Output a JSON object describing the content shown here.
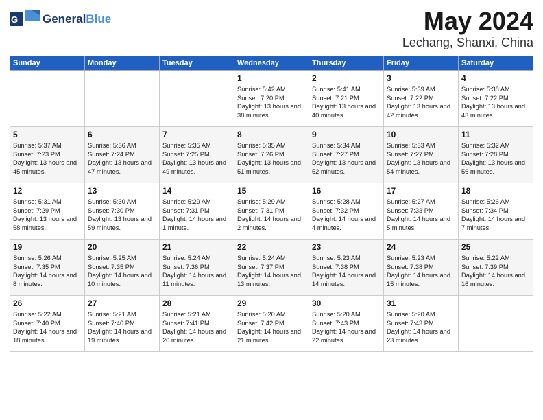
{
  "header": {
    "logo_general": "General",
    "logo_blue": "Blue",
    "month": "May 2024",
    "location": "Lechang, Shanxi, China"
  },
  "weekdays": [
    "Sunday",
    "Monday",
    "Tuesday",
    "Wednesday",
    "Thursday",
    "Friday",
    "Saturday"
  ],
  "weeks": [
    [
      {
        "day": "",
        "sunrise": "",
        "sunset": "",
        "daylight": ""
      },
      {
        "day": "",
        "sunrise": "",
        "sunset": "",
        "daylight": ""
      },
      {
        "day": "",
        "sunrise": "",
        "sunset": "",
        "daylight": ""
      },
      {
        "day": "1",
        "sunrise": "Sunrise: 5:42 AM",
        "sunset": "Sunset: 7:20 PM",
        "daylight": "Daylight: 13 hours and 38 minutes."
      },
      {
        "day": "2",
        "sunrise": "Sunrise: 5:41 AM",
        "sunset": "Sunset: 7:21 PM",
        "daylight": "Daylight: 13 hours and 40 minutes."
      },
      {
        "day": "3",
        "sunrise": "Sunrise: 5:39 AM",
        "sunset": "Sunset: 7:22 PM",
        "daylight": "Daylight: 13 hours and 42 minutes."
      },
      {
        "day": "4",
        "sunrise": "Sunrise: 5:38 AM",
        "sunset": "Sunset: 7:22 PM",
        "daylight": "Daylight: 13 hours and 43 minutes."
      }
    ],
    [
      {
        "day": "5",
        "sunrise": "Sunrise: 5:37 AM",
        "sunset": "Sunset: 7:23 PM",
        "daylight": "Daylight: 13 hours and 45 minutes."
      },
      {
        "day": "6",
        "sunrise": "Sunrise: 5:36 AM",
        "sunset": "Sunset: 7:24 PM",
        "daylight": "Daylight: 13 hours and 47 minutes."
      },
      {
        "day": "7",
        "sunrise": "Sunrise: 5:35 AM",
        "sunset": "Sunset: 7:25 PM",
        "daylight": "Daylight: 13 hours and 49 minutes."
      },
      {
        "day": "8",
        "sunrise": "Sunrise: 5:35 AM",
        "sunset": "Sunset: 7:26 PM",
        "daylight": "Daylight: 13 hours and 51 minutes."
      },
      {
        "day": "9",
        "sunrise": "Sunrise: 5:34 AM",
        "sunset": "Sunset: 7:27 PM",
        "daylight": "Daylight: 13 hours and 52 minutes."
      },
      {
        "day": "10",
        "sunrise": "Sunrise: 5:33 AM",
        "sunset": "Sunset: 7:27 PM",
        "daylight": "Daylight: 13 hours and 54 minutes."
      },
      {
        "day": "11",
        "sunrise": "Sunrise: 5:32 AM",
        "sunset": "Sunset: 7:28 PM",
        "daylight": "Daylight: 13 hours and 56 minutes."
      }
    ],
    [
      {
        "day": "12",
        "sunrise": "Sunrise: 5:31 AM",
        "sunset": "Sunset: 7:29 PM",
        "daylight": "Daylight: 13 hours and 58 minutes."
      },
      {
        "day": "13",
        "sunrise": "Sunrise: 5:30 AM",
        "sunset": "Sunset: 7:30 PM",
        "daylight": "Daylight: 13 hours and 59 minutes."
      },
      {
        "day": "14",
        "sunrise": "Sunrise: 5:29 AM",
        "sunset": "Sunset: 7:31 PM",
        "daylight": "Daylight: 14 hours and 1 minute."
      },
      {
        "day": "15",
        "sunrise": "Sunrise: 5:29 AM",
        "sunset": "Sunset: 7:31 PM",
        "daylight": "Daylight: 14 hours and 2 minutes."
      },
      {
        "day": "16",
        "sunrise": "Sunrise: 5:28 AM",
        "sunset": "Sunset: 7:32 PM",
        "daylight": "Daylight: 14 hours and 4 minutes."
      },
      {
        "day": "17",
        "sunrise": "Sunrise: 5:27 AM",
        "sunset": "Sunset: 7:33 PM",
        "daylight": "Daylight: 14 hours and 5 minutes."
      },
      {
        "day": "18",
        "sunrise": "Sunrise: 5:26 AM",
        "sunset": "Sunset: 7:34 PM",
        "daylight": "Daylight: 14 hours and 7 minutes."
      }
    ],
    [
      {
        "day": "19",
        "sunrise": "Sunrise: 5:26 AM",
        "sunset": "Sunset: 7:35 PM",
        "daylight": "Daylight: 14 hours and 8 minutes."
      },
      {
        "day": "20",
        "sunrise": "Sunrise: 5:25 AM",
        "sunset": "Sunset: 7:35 PM",
        "daylight": "Daylight: 14 hours and 10 minutes."
      },
      {
        "day": "21",
        "sunrise": "Sunrise: 5:24 AM",
        "sunset": "Sunset: 7:36 PM",
        "daylight": "Daylight: 14 hours and 11 minutes."
      },
      {
        "day": "22",
        "sunrise": "Sunrise: 5:24 AM",
        "sunset": "Sunset: 7:37 PM",
        "daylight": "Daylight: 14 hours and 13 minutes."
      },
      {
        "day": "23",
        "sunrise": "Sunrise: 5:23 AM",
        "sunset": "Sunset: 7:38 PM",
        "daylight": "Daylight: 14 hours and 14 minutes."
      },
      {
        "day": "24",
        "sunrise": "Sunrise: 5:23 AM",
        "sunset": "Sunset: 7:38 PM",
        "daylight": "Daylight: 14 hours and 15 minutes."
      },
      {
        "day": "25",
        "sunrise": "Sunrise: 5:22 AM",
        "sunset": "Sunset: 7:39 PM",
        "daylight": "Daylight: 14 hours and 16 minutes."
      }
    ],
    [
      {
        "day": "26",
        "sunrise": "Sunrise: 5:22 AM",
        "sunset": "Sunset: 7:40 PM",
        "daylight": "Daylight: 14 hours and 18 minutes."
      },
      {
        "day": "27",
        "sunrise": "Sunrise: 5:21 AM",
        "sunset": "Sunset: 7:40 PM",
        "daylight": "Daylight: 14 hours and 19 minutes."
      },
      {
        "day": "28",
        "sunrise": "Sunrise: 5:21 AM",
        "sunset": "Sunset: 7:41 PM",
        "daylight": "Daylight: 14 hours and 20 minutes."
      },
      {
        "day": "29",
        "sunrise": "Sunrise: 5:20 AM",
        "sunset": "Sunset: 7:42 PM",
        "daylight": "Daylight: 14 hours and 21 minutes."
      },
      {
        "day": "30",
        "sunrise": "Sunrise: 5:20 AM",
        "sunset": "Sunset: 7:43 PM",
        "daylight": "Daylight: 14 hours and 22 minutes."
      },
      {
        "day": "31",
        "sunrise": "Sunrise: 5:20 AM",
        "sunset": "Sunset: 7:43 PM",
        "daylight": "Daylight: 14 hours and 23 minutes."
      },
      {
        "day": "",
        "sunrise": "",
        "sunset": "",
        "daylight": ""
      }
    ]
  ]
}
